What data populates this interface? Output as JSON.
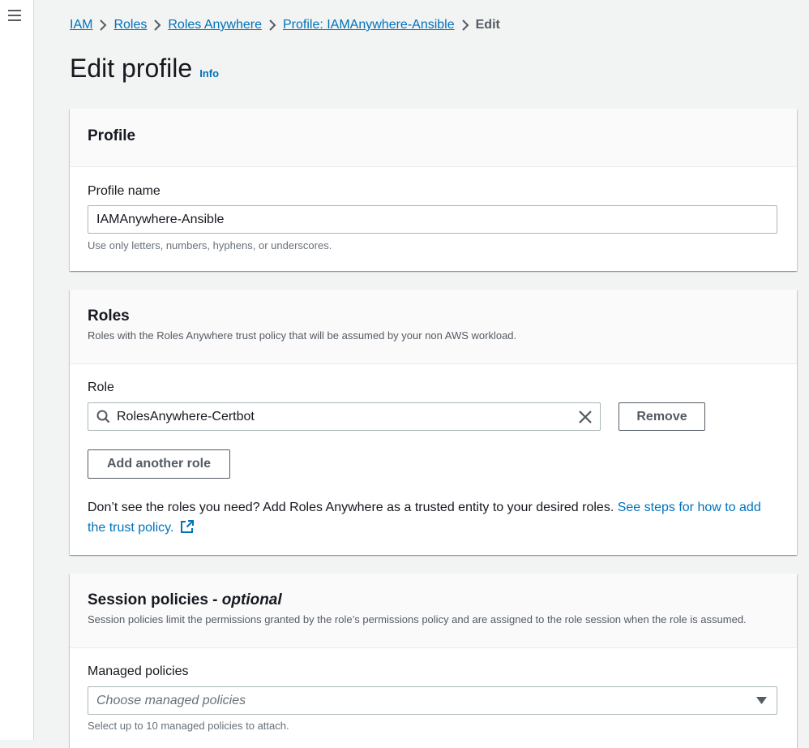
{
  "nav": {
    "menu_icon": "hamburger-menu-icon"
  },
  "breadcrumb": {
    "items": [
      "IAM",
      "Roles",
      "Roles Anywhere",
      "Profile: IAMAnywhere-Ansible"
    ],
    "current": "Edit"
  },
  "page": {
    "title": "Edit profile",
    "info": "Info"
  },
  "profile": {
    "title": "Profile",
    "name_label": "Profile name",
    "name_value": "IAMAnywhere-Ansible",
    "name_hint": "Use only letters, numbers, hyphens, or underscores."
  },
  "roles": {
    "title": "Roles",
    "description": "Roles with the Roles Anywhere trust policy that will be assumed by your non AWS workload.",
    "role_label": "Role",
    "role_value": "RolesAnywhere-Certbot",
    "remove_label": "Remove",
    "add_label": "Add another role",
    "help_text": "Don’t see the roles you need? Add Roles Anywhere as a trusted entity to your desired roles. ",
    "help_link": "See steps for how to add the trust policy."
  },
  "session": {
    "title": "Session policies - ",
    "title_optional": "optional",
    "description": "Session policies limit the permissions granted by the role’s permissions policy and are assigned to the role session when the role is assumed.",
    "managed_label": "Managed policies",
    "managed_placeholder": "Choose managed policies",
    "managed_hint": "Select up to 10 managed policies to attach."
  },
  "colors": {
    "link": "#0073bb",
    "text": "#16191f",
    "muted": "#545b64",
    "background": "#f2f3f3"
  }
}
